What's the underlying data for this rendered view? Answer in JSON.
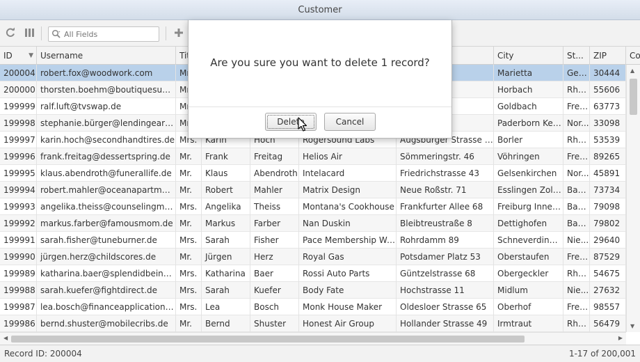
{
  "window": {
    "title": "Customer"
  },
  "toolbar": {
    "refresh_icon": "refresh-icon",
    "columns_icon": "columns-icon",
    "search_placeholder": "All Fields",
    "add_icon": "plus-icon"
  },
  "grid": {
    "columns": [
      "ID",
      "Username",
      "Tit",
      "",
      "",
      "",
      "",
      "City",
      "St...",
      "ZIP",
      "Co"
    ],
    "rows": [
      [
        "200004",
        "robert.fox@woodwork.com",
        "Mr",
        "",
        "",
        "",
        "t",
        "Marietta",
        "Geo...",
        "30444"
      ],
      [
        "200000",
        "thorsten.boehm@boutiquesuppo...",
        "Mr",
        "",
        "",
        "",
        "atz 90",
        "Horbach",
        "Rhe...",
        "55606"
      ],
      [
        "199999",
        "ralf.luft@tvswap.de",
        "Mr",
        "",
        "",
        "",
        "38",
        "Goldbach",
        "Frei...",
        "63773"
      ],
      [
        "199998",
        "stephanie.bürger@lendingears.de",
        "Mr",
        "",
        "",
        "",
        "e 38",
        "Paderborn Ker...",
        "Nor...",
        "33098"
      ],
      [
        "199997",
        "karin.hoch@secondhandtires.de",
        "Mrs.",
        "Karin",
        "Hoch",
        "Rogersound Labs",
        "Augsburger Strasse 35",
        "Borler",
        "Rhe...",
        "53539"
      ],
      [
        "199996",
        "frank.freitag@dessertspring.de",
        "Mr.",
        "Frank",
        "Freitag",
        "Helios Air",
        "Sömmeringstr. 46",
        "Vöhringen",
        "Frei...",
        "89265"
      ],
      [
        "199995",
        "klaus.abendroth@funerallife.de",
        "Mr.",
        "Klaus",
        "Abendroth",
        "Intelacard",
        "Friedrichstrasse 43",
        "Gelsenkirchen",
        "Nor...",
        "45891"
      ],
      [
        "199994",
        "robert.mahler@oceanapartment....",
        "Mr.",
        "Robert",
        "Mahler",
        "Matrix Design",
        "Neue Roßstr. 71",
        "Esslingen Zollb...",
        "Bad...",
        "73734"
      ],
      [
        "199993",
        "angelika.theiss@counselingmate...",
        "Mrs.",
        "Angelika",
        "Theiss",
        "Montana's Cookhouse",
        "Frankfurter Allee 68",
        "Freiburg Innen...",
        "Bad...",
        "79098"
      ],
      [
        "199992",
        "markus.farber@famousmom.de",
        "Mr.",
        "Markus",
        "Farber",
        "Nan Duskin",
        "Bleibtreustraße 8",
        "Dettighofen",
        "Bad...",
        "79802"
      ],
      [
        "199991",
        "sarah.fisher@tuneburner.de",
        "Mrs.",
        "Sarah",
        "Fisher",
        "Pace Membership War...",
        "Rohrdamm 89",
        "Schneverdingen",
        "Nie...",
        "29640"
      ],
      [
        "199990",
        "jürgen.herz@childscores.de",
        "Mr.",
        "Jürgen",
        "Herz",
        "Royal Gas",
        "Potsdamer Platz 53",
        "Oberstaufen",
        "Frei...",
        "87529"
      ],
      [
        "199989",
        "katharina.baer@splendidbeing.de",
        "Mrs.",
        "Katharina",
        "Baer",
        "Rossi Auto Parts",
        "Güntzelstrasse 68",
        "Obergeckler",
        "Rhe...",
        "54675"
      ],
      [
        "199988",
        "sarah.kuefer@fightdirect.de",
        "Mrs.",
        "Sarah",
        "Kuefer",
        "Body Fate",
        "Hochstrasse 11",
        "Midlum",
        "Nie...",
        "27632"
      ],
      [
        "199987",
        "lea.bosch@financeapplications.de",
        "Mrs.",
        "Lea",
        "Bosch",
        "Monk House Maker",
        "Oldesloer Strasse 65",
        "Oberhof",
        "Frei...",
        "98557"
      ],
      [
        "199986",
        "bernd.shuster@mobilecribs.de",
        "Mr.",
        "Bernd",
        "Shuster",
        "Honest Air Group",
        "Hollander Strasse 49",
        "Irmtraut",
        "Rhe...",
        "56479"
      ]
    ]
  },
  "status": {
    "record": "Record ID: 200004",
    "count": "1-17 of 200,001"
  },
  "dialog": {
    "message": "Are you sure you want to delete 1 record?",
    "delete_label": "Delete",
    "cancel_label": "Cancel"
  }
}
